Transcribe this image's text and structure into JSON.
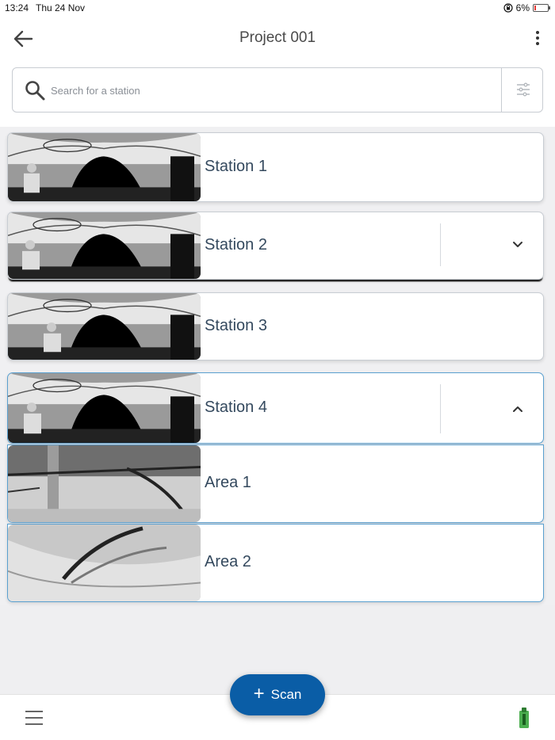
{
  "status": {
    "time": "13:24",
    "date": "Thu 24 Nov",
    "battery": "6%",
    "battery_level": 0.06,
    "icons": [
      "orientation-lock-icon",
      "battery-icon"
    ]
  },
  "header": {
    "title": "Project 001",
    "icons": [
      "arrow-left-icon",
      "more-vertical-icon"
    ]
  },
  "search": {
    "placeholder": "Search for a station",
    "value": "",
    "icons": [
      "search-icon",
      "filter-sliders-icon"
    ]
  },
  "stations": [
    {
      "label": "Station 1"
    },
    {
      "label": "Station 2",
      "expandable": true,
      "expanded": false
    },
    {
      "label": "Station 3"
    },
    {
      "label": "Station 4",
      "expandable": true,
      "expanded": true
    }
  ],
  "areas": [
    {
      "label": "Area 1"
    },
    {
      "label": "Area 2"
    }
  ],
  "scan_button": {
    "label": "Scan"
  },
  "bottom": {
    "icons": [
      "hamburger-menu-icon",
      "scanner-device-icon"
    ]
  },
  "colors": {
    "accent": "#0a5da6",
    "text": "#34495e",
    "expanded_border": "#5aa0d0",
    "device_green": "#4caf50",
    "battery_low": "#e53935"
  }
}
